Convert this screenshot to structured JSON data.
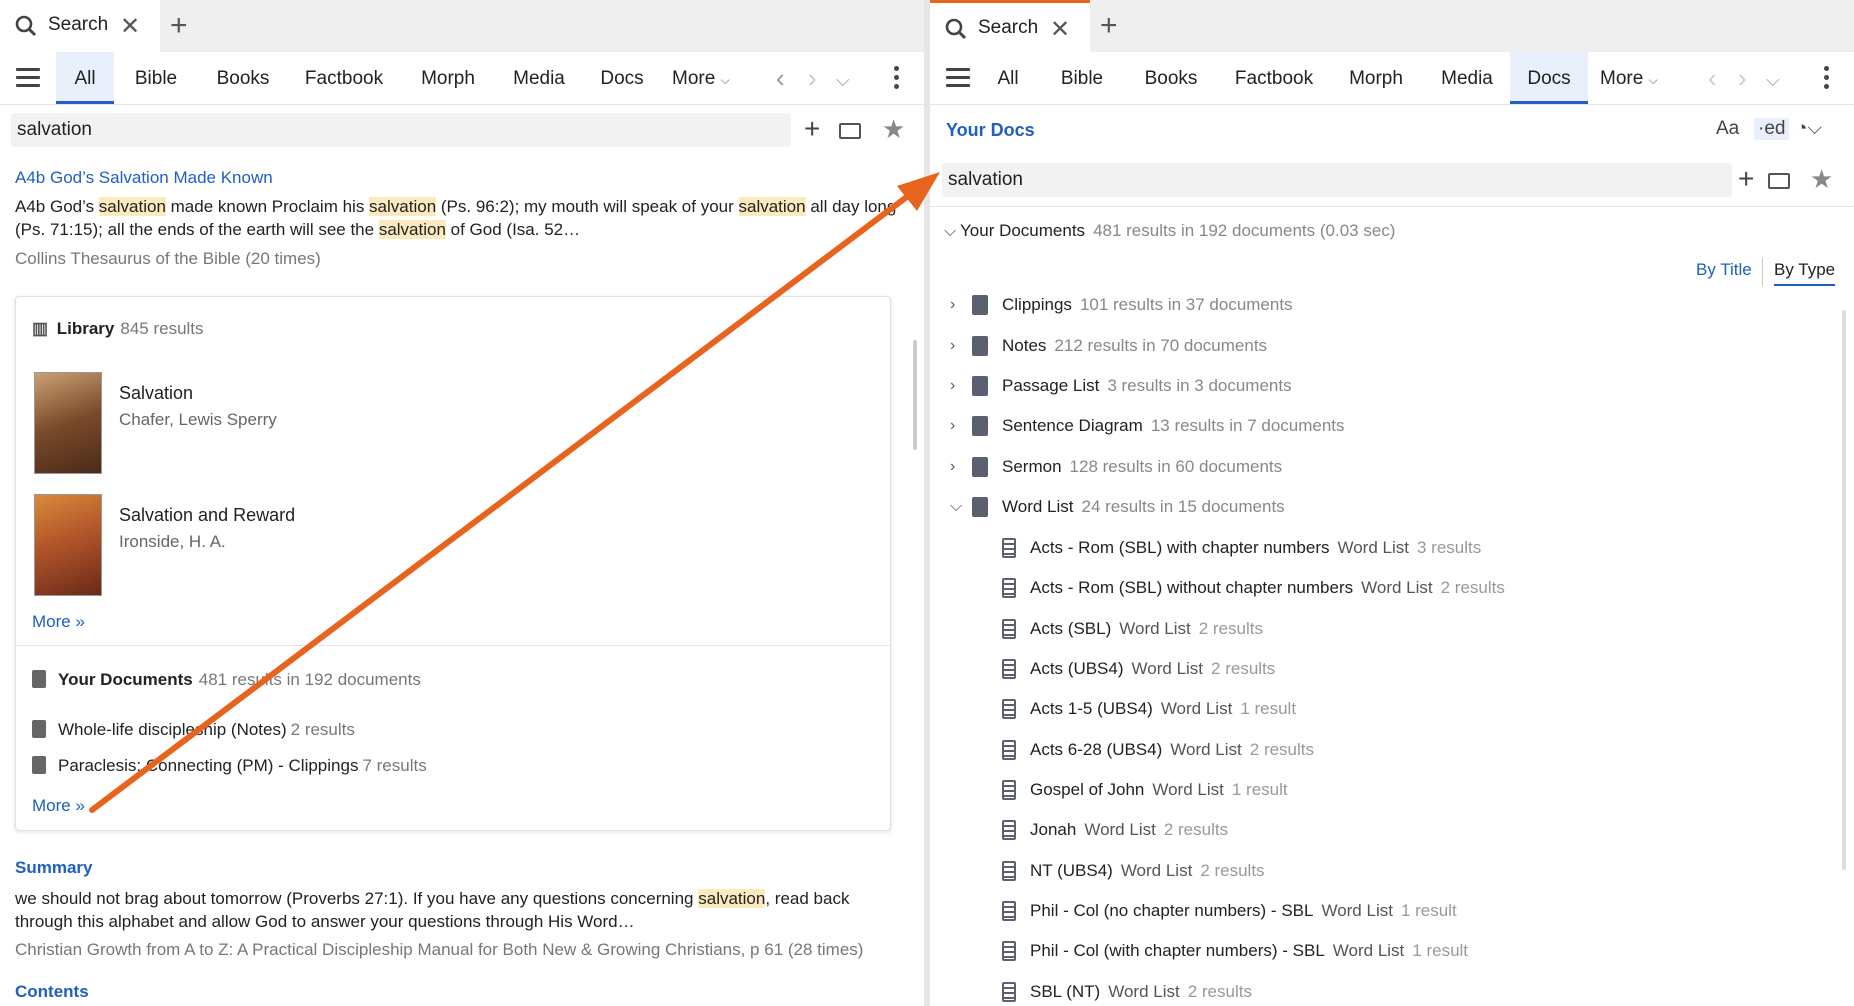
{
  "left": {
    "tab": {
      "label": "Search"
    },
    "nav": {
      "tabs": [
        "All",
        "Bible",
        "Books",
        "Factbook",
        "Morph",
        "Media",
        "Docs"
      ],
      "more": "More"
    },
    "search": {
      "value": "salvation"
    },
    "hit1": {
      "title": "A4b God’s Salvation Made Known",
      "t1": "A4b God’s ",
      "h1": "salvation",
      "t2": " made known Proclaim his ",
      "h2": "salvation",
      "t3": " (Ps. 96:2); my mouth will speak of your ",
      "h3": "salvation",
      "t4": " all day long (Ps. 71:15); all the ends of the earth will see the ",
      "h4": "salvation",
      "t5": " of God (Isa. 52…",
      "source": "Collins Thesaurus of the Bible (20 times)"
    },
    "library": {
      "label": "Library",
      "count": "845 results",
      "books": [
        {
          "title": "Salvation",
          "author": "Chafer, Lewis Sperry"
        },
        {
          "title": "Salvation and Reward",
          "author": "Ironside, H. A."
        }
      ],
      "more": "More »"
    },
    "docs": {
      "label": "Your Documents",
      "count": "481 results in 192 documents",
      "rows": [
        {
          "title": "Whole-life discipleship (Notes)",
          "count": "2 results"
        },
        {
          "title": "Paraclesis: Connecting (PM) - Clippings",
          "count": "7 results"
        }
      ],
      "more": "More »"
    },
    "hit2": {
      "title": "Summary",
      "t1": "we should not brag about tomorrow (Proverbs 27:1). If you have any questions concerning ",
      "h1": "salvation",
      "t2": ", read back through this alphabet and allow God to answer your questions through His Word…",
      "source": "Christian Growth from A to Z: A Practical Discipleship Manual for Both New & Growing Christians, p 61 (28 times)"
    },
    "hit3": {
      "title": "Contents"
    }
  },
  "right": {
    "tab": {
      "label": "Search"
    },
    "nav": {
      "tabs": [
        "All",
        "Bible",
        "Books",
        "Factbook",
        "Morph",
        "Media",
        "Docs"
      ],
      "more": "More",
      "active": "Docs"
    },
    "title": "Your Docs",
    "tools": {
      "font": "Aa",
      "ed": "·ed"
    },
    "search": {
      "value": "salvation"
    },
    "tree": {
      "label": "Your Documents",
      "meta": "481 results in 192 documents (0.03 sec)",
      "by_title": "By Title",
      "by_type": "By Type",
      "categories": [
        {
          "name": "Clippings",
          "meta": "101 results in 37 documents"
        },
        {
          "name": "Notes",
          "meta": "212 results in 70 documents"
        },
        {
          "name": "Passage List",
          "meta": "3 results in 3 documents"
        },
        {
          "name": "Sentence Diagram",
          "meta": "13 results in 7 documents"
        },
        {
          "name": "Sermon",
          "meta": "128 results in 60 documents"
        },
        {
          "name": "Word List",
          "meta": "24 results in 15 documents"
        }
      ],
      "word_lists": [
        {
          "name": "Acts - Rom (SBL) with chapter numbers",
          "type": "Word List",
          "meta": "3 results"
        },
        {
          "name": "Acts - Rom (SBL) without chapter numbers",
          "type": "Word List",
          "meta": "2 results"
        },
        {
          "name": "Acts (SBL)",
          "type": "Word List",
          "meta": "2 results"
        },
        {
          "name": "Acts (UBS4)",
          "type": "Word List",
          "meta": "2 results"
        },
        {
          "name": "Acts 1-5 (UBS4)",
          "type": "Word List",
          "meta": "1 result"
        },
        {
          "name": "Acts 6-28 (UBS4)",
          "type": "Word List",
          "meta": "2 results"
        },
        {
          "name": "Gospel of John",
          "type": "Word List",
          "meta": "1 result"
        },
        {
          "name": "Jonah",
          "type": "Word List",
          "meta": "2 results"
        },
        {
          "name": "NT (UBS4)",
          "type": "Word List",
          "meta": "2 results"
        },
        {
          "name": "Phil - Col (no chapter numbers) - SBL",
          "type": "Word List",
          "meta": "1 result"
        },
        {
          "name": "Phil - Col (with chapter numbers) - SBL",
          "type": "Word List",
          "meta": "1 result"
        },
        {
          "name": "SBL (NT)",
          "type": "Word List",
          "meta": "2 results"
        }
      ]
    }
  },
  "colors": {
    "link": "#1f5fbf",
    "highlight": "#fbeac0",
    "arrow": "#e8641e"
  }
}
